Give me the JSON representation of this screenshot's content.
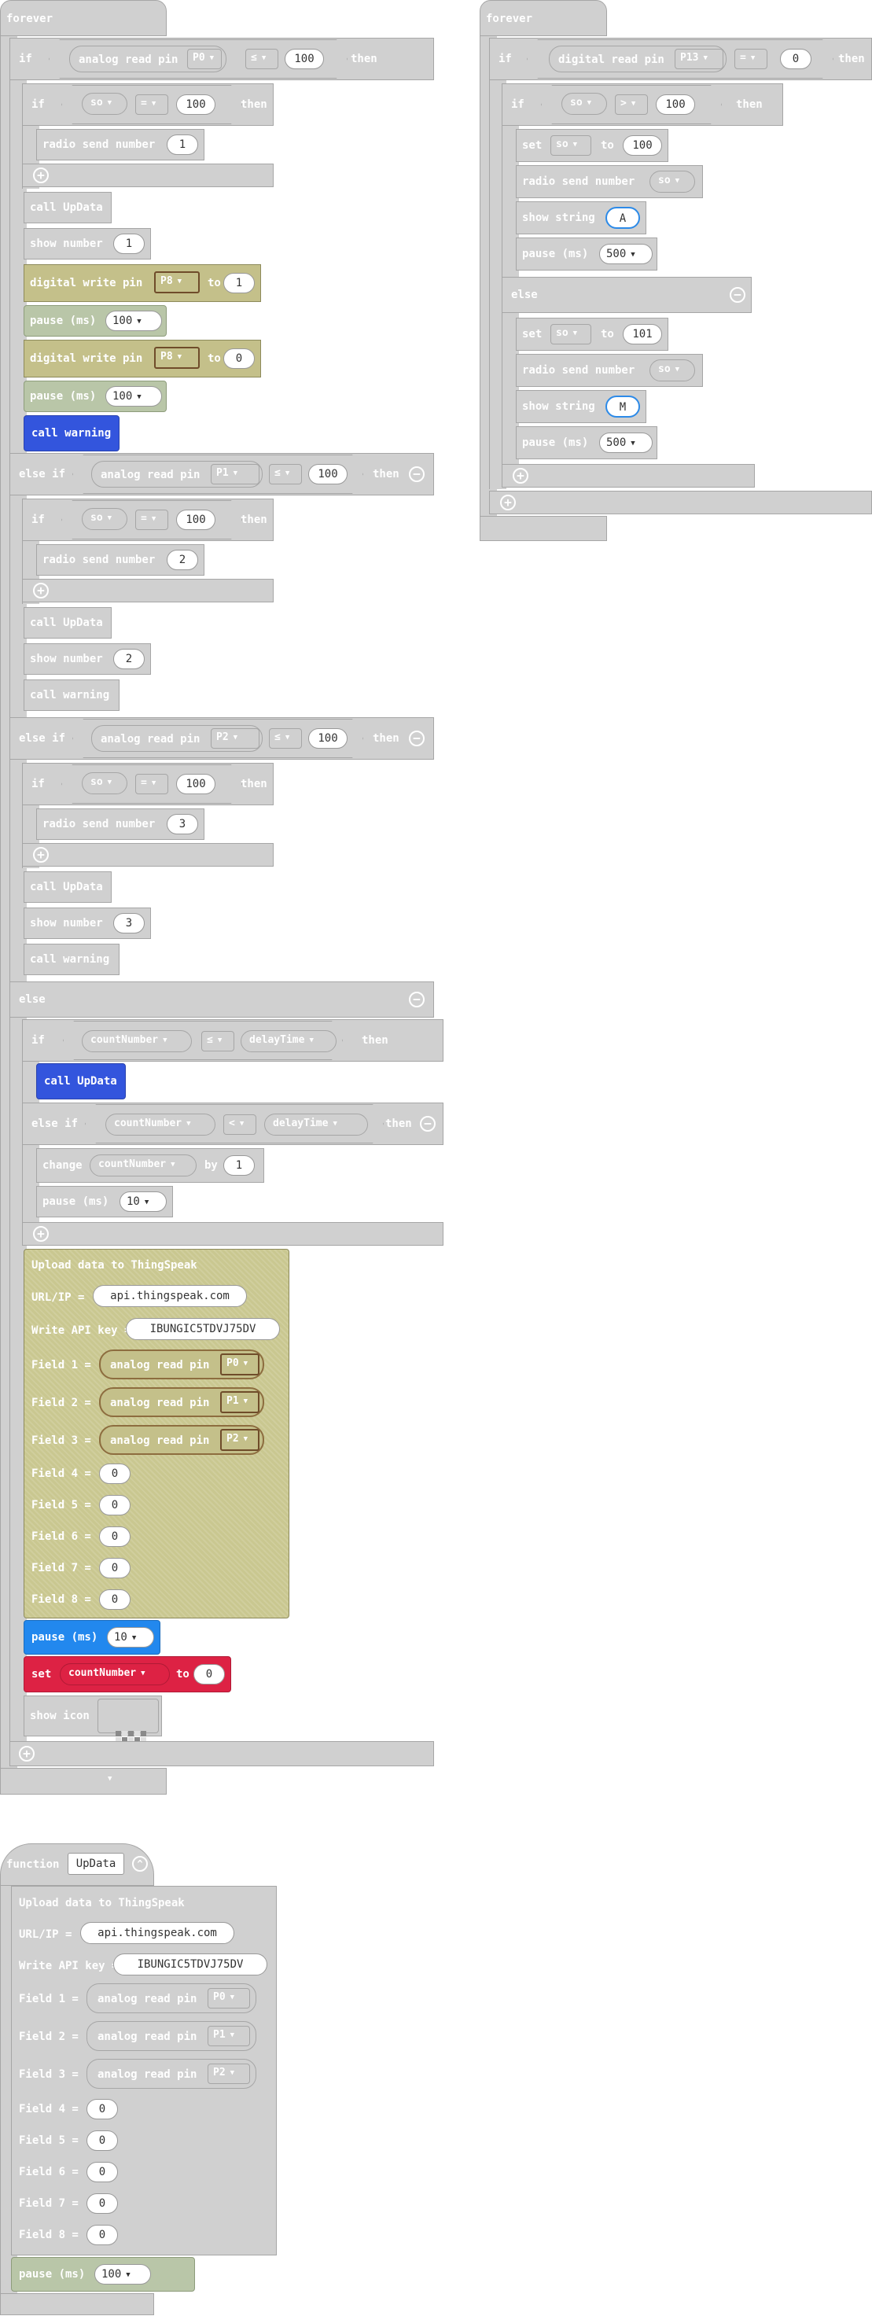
{
  "kw": {
    "forever": "forever",
    "if": "if",
    "then": "then",
    "else_if": "else if",
    "else": "else",
    "analog_read_pin": "analog read pin",
    "digital_read_pin": "digital read pin",
    "radio_send_number": "radio send number",
    "call_updata": "call UpData",
    "call_warning": "call warning",
    "show_number": "show number",
    "digital_write_pin": "digital write pin",
    "to": "to",
    "pause_ms": "pause (ms)",
    "set": "set",
    "show_string": "show string",
    "change": "change",
    "by": "by",
    "show_icon": "show icon",
    "upload": "Upload data to ThingSpeak",
    "url_ip": "URL/IP =",
    "write_api_key": "Write API key =",
    "field1": "Field 1 =",
    "field2": "Field 2 =",
    "field3": "Field 3 =",
    "field4": "Field 4 =",
    "field5": "Field 5 =",
    "field6": "Field 6 =",
    "field7": "Field 7 =",
    "field8": "Field 8 =",
    "function": "function",
    "updata_name": "UpData"
  },
  "vals": {
    "p0": "P0",
    "p1": "P1",
    "p2": "P2",
    "p8": "P8",
    "p13": "P13",
    "op_le": "≤",
    "op_eq": "=",
    "op_gt": ">",
    "op_lt": "<",
    "so": "so",
    "countNumber": "countNumber",
    "delayTime": "delayTime",
    "n100": "100",
    "n1": "1",
    "n2": "2",
    "n3": "3",
    "n0": "0",
    "n101": "101",
    "n10": "10",
    "n500": "500",
    "str_a": "A",
    "str_m": "M",
    "url": "api.thingspeak.com",
    "api_key": "IBUNGIC5TDVJ75DV"
  }
}
